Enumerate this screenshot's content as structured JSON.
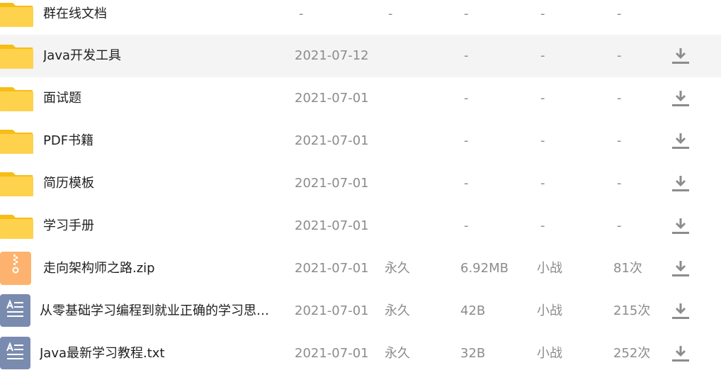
{
  "colors": {
    "folder": "#ffd24d",
    "folder_tab": "#f6bd16",
    "zip": "#fdb36f",
    "txt": "#7a8bb0",
    "download_icon": "#8c8c8c",
    "hover_row": "#f4f4f4"
  },
  "rows": [
    {
      "icon": "folder-icon",
      "name": "群在线文档",
      "date": "-",
      "expire": "-",
      "size": "-",
      "owner": "-",
      "count": "-"
    },
    {
      "icon": "folder-icon",
      "name": "Java开发工具",
      "date": "2021-07-12",
      "expire": "-",
      "size": "-",
      "owner": "-",
      "count": "-",
      "download_icon": "download-icon"
    },
    {
      "icon": "folder-icon",
      "name": "面试题",
      "date": "2021-07-01",
      "expire": "-",
      "size": "-",
      "owner": "-",
      "count": "-",
      "download_icon": "download-icon"
    },
    {
      "icon": "folder-icon",
      "name": "PDF书籍",
      "date": "2021-07-01",
      "expire": "-",
      "size": "-",
      "owner": "-",
      "count": "-",
      "download_icon": "download-icon"
    },
    {
      "icon": "folder-icon",
      "name": "简历模板",
      "date": "2021-07-01",
      "expire": "-",
      "size": "-",
      "owner": "-",
      "count": "-",
      "download_icon": "download-icon"
    },
    {
      "icon": "folder-icon",
      "name": "学习手册",
      "date": "2021-07-01",
      "expire": "-",
      "size": "-",
      "owner": "-",
      "count": "-",
      "download_icon": "download-icon"
    },
    {
      "icon": "zip-file-icon",
      "name": "走向架构师之路.zip",
      "date": "2021-07-01",
      "expire": "永久",
      "size": "6.92MB",
      "owner": "小战",
      "count": "81次",
      "download_icon": "download-icon"
    },
    {
      "icon": "txt-file-icon",
      "name": "从零基础学习编程到就业正确的学习思…",
      "date": "2021-07-01",
      "expire": "永久",
      "size": "42B",
      "owner": "小战",
      "count": "215次",
      "download_icon": "download-icon"
    },
    {
      "icon": "txt-file-icon",
      "name": "Java最新学习教程.txt",
      "date": "2021-07-01",
      "expire": "永久",
      "size": "32B",
      "owner": "小战",
      "count": "252次",
      "download_icon": "download-icon"
    }
  ]
}
